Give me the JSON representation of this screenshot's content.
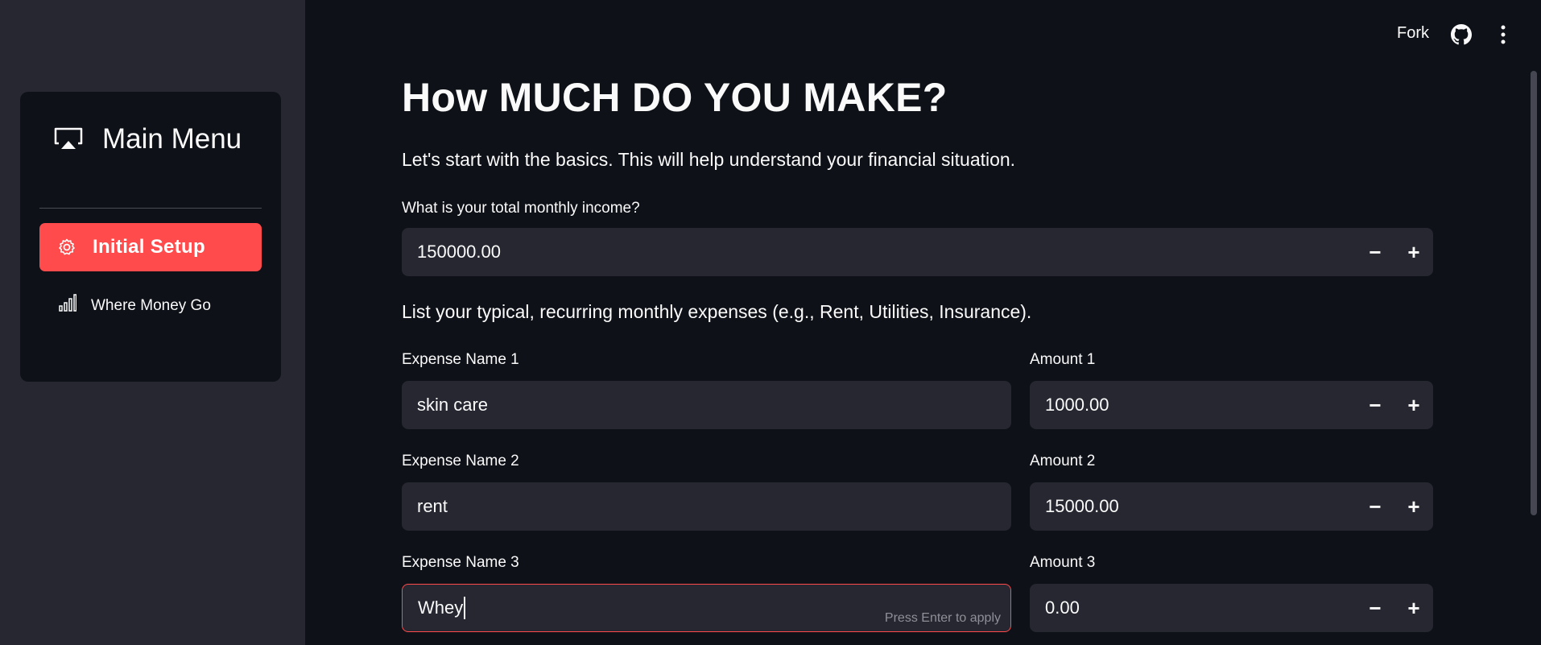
{
  "sidebar": {
    "menu_title": "Main Menu",
    "items": [
      {
        "label": "Initial Setup",
        "icon": "gear-icon",
        "active": true
      },
      {
        "label": "Where Money Go",
        "icon": "bar-chart-icon",
        "active": false
      }
    ],
    "accent_color": "#ff4b4b"
  },
  "topbar": {
    "fork_label": "Fork",
    "github_icon": "github-icon",
    "more_icon": "more-vertical-icon"
  },
  "main": {
    "title": "How MUCH DO YOU MAKE?",
    "intro": "Let's start with the basics. This will help understand your financial situation.",
    "income_label": "What is your total monthly income?",
    "income_value": "150000.00",
    "expenses_intro": "List your typical, recurring monthly expenses (e.g., Rent, Utilities, Insurance).",
    "expenses": [
      {
        "name_label": "Expense Name 1",
        "name_value": "skin care",
        "amount_label": "Amount 1",
        "amount_value": "1000.00"
      },
      {
        "name_label": "Expense Name 2",
        "name_value": "rent",
        "amount_label": "Amount 2",
        "amount_value": "15000.00"
      },
      {
        "name_label": "Expense Name 3",
        "name_value": "Whey",
        "amount_label": "Amount 3",
        "amount_value": "0.00",
        "hint": "Press Enter to apply"
      }
    ],
    "minus": "−",
    "plus": "+"
  }
}
